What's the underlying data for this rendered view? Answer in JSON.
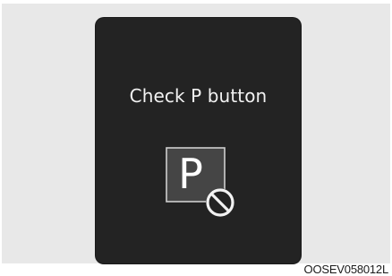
{
  "display": {
    "message": "Check P button",
    "icon_letter": "P",
    "icon": "park-button-prohibited-icon"
  },
  "figure": {
    "ref_code": "OOSEV058012L"
  },
  "colors": {
    "display_bg": "#232323",
    "frame_bg": "#e8e8e8",
    "icon_box": "#454545",
    "text": "#f2f2f2"
  }
}
